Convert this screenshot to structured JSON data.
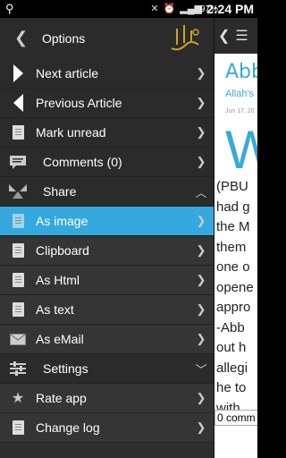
{
  "statusbar": {
    "left_icon": "usb-icon",
    "battery": "97%",
    "time": "2:24 PM"
  },
  "drawer": {
    "title": "Options",
    "items": [
      {
        "label": "Next article",
        "icon": "arrow-right-icon",
        "chev": "❯"
      },
      {
        "label": "Previous Article",
        "icon": "arrow-left-icon",
        "chev": "❯"
      },
      {
        "label": "Mark unread",
        "icon": "document-icon",
        "chev": "❯"
      },
      {
        "label": "Comments (0)",
        "icon": "comment-icon",
        "chev": "❯"
      },
      {
        "label": "Share",
        "icon": "share-icon",
        "chev": "︿"
      },
      {
        "label": "As image",
        "icon": "image-icon",
        "chev": "❯"
      },
      {
        "label": "Clipboard",
        "icon": "clipboard-icon",
        "chev": "❯"
      },
      {
        "label": "As Html",
        "icon": "html-icon",
        "chev": "❯"
      },
      {
        "label": "As text",
        "icon": "text-icon",
        "chev": "❯"
      },
      {
        "label": "As eMail",
        "icon": "mail-icon",
        "chev": "❯"
      },
      {
        "label": "Settings",
        "icon": "settings-icon",
        "chev": "﹀"
      },
      {
        "label": "Rate app",
        "icon": "star-icon",
        "chev": "❯"
      },
      {
        "label": "Change log",
        "icon": "changelog-icon",
        "chev": "❯"
      }
    ]
  },
  "article": {
    "title": "Abb",
    "subtitle": "Allah's",
    "date": "Jun 17, 20",
    "big_letter": "W",
    "lines": [
      "(PBU",
      "had g",
      "the M",
      "them",
      "one o",
      "opene",
      "appro",
      "-Abb",
      "out h",
      "allegi",
      "he to",
      "with"
    ],
    "comments": "0 comm"
  },
  "colors": {
    "accent": "#35a8dd",
    "drawer_bg": "#2e2e2e"
  }
}
